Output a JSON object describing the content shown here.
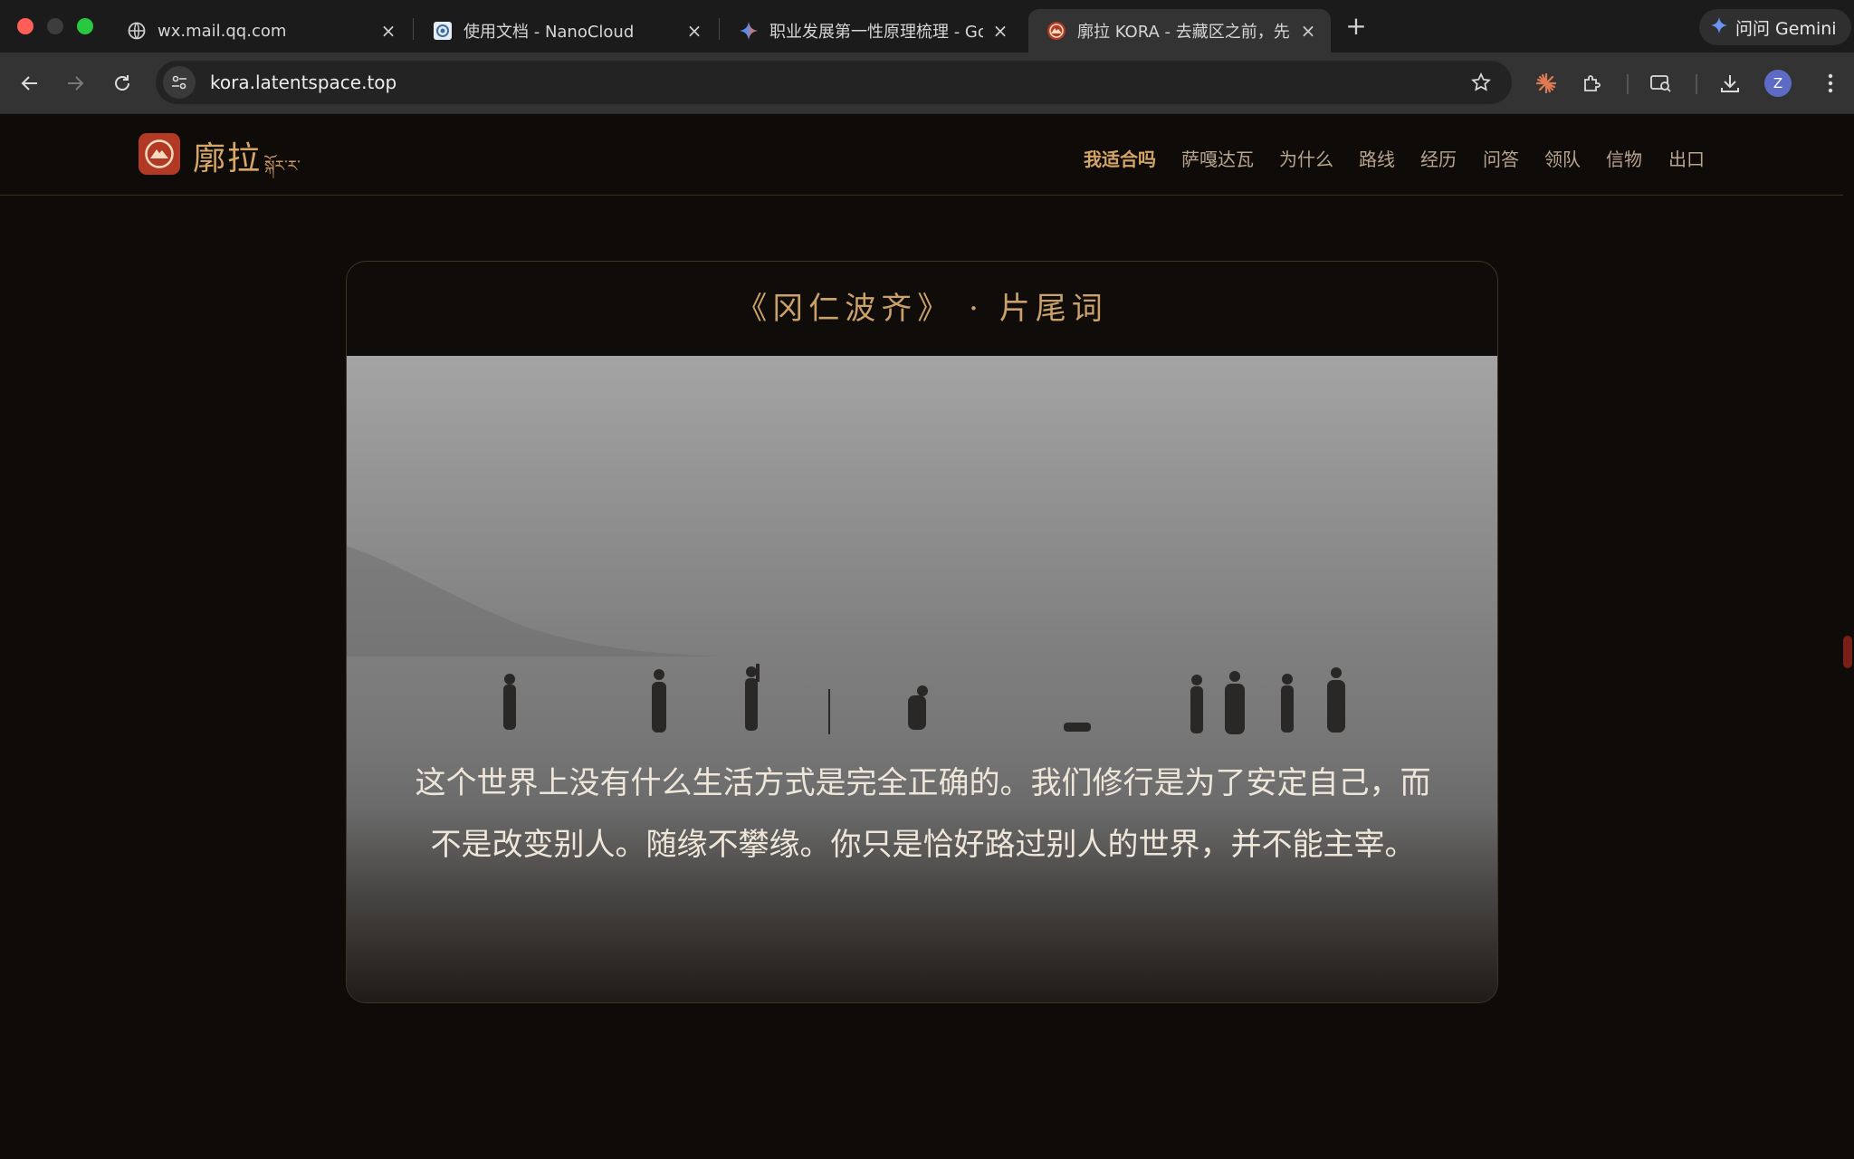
{
  "browser": {
    "tabs": [
      {
        "title": "wx.mail.qq.com",
        "icon": "globe-icon",
        "active": false
      },
      {
        "title": "使用文档 - NanoCloud",
        "icon": "nanocloud-icon",
        "active": false
      },
      {
        "title": "职业发展第一性原理梳理 - Goo",
        "icon": "gemini-sparkle-icon",
        "active": false
      },
      {
        "title": "廓拉 KORA - 去藏区之前，先学",
        "icon": "kora-icon",
        "active": true
      }
    ],
    "new_tab_label": "+",
    "close_label": "×",
    "gemini_button": "问问 Gemini",
    "url": "kora.latentspace.top",
    "profile_initial": "Z"
  },
  "site": {
    "logo_text": "廓拉",
    "logo_subtext": "སྐོར་ར་",
    "nav": [
      "我适合吗",
      "萨嘎达瓦",
      "为什么",
      "路线",
      "经历",
      "问答",
      "领队",
      "信物",
      "出口"
    ],
    "active_nav": "我适合吗",
    "accent_color": "#d3a566"
  },
  "card": {
    "title": "《冈仁波齐》 · 片尾词",
    "quote": "这个世界上没有什么生活方式是完全正确的。我们修行是为了安定自己，而不是改变别人。随缘不攀缘。你只是恰好路过别人的世界，并不能主宰。"
  }
}
